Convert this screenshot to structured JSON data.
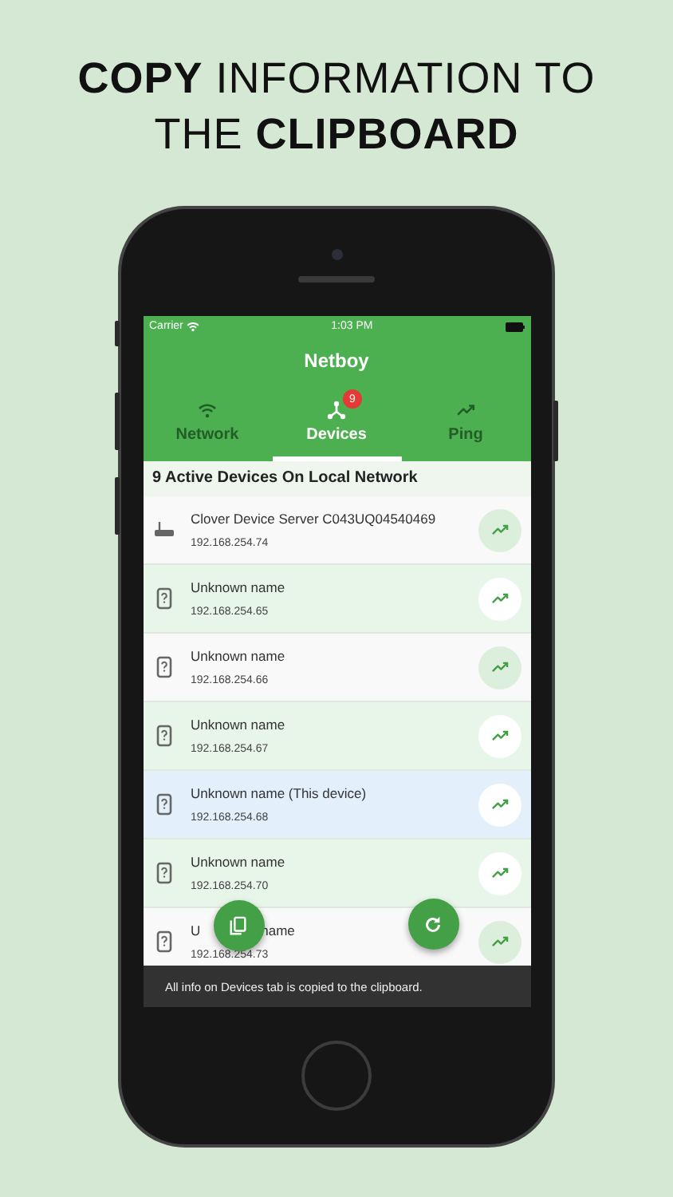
{
  "headline": "**COPY** INFORMATION TO THE **CLIPBOARD**",
  "status_bar": {
    "carrier": "Carrier",
    "time": "1:03 PM"
  },
  "app_bar": {
    "title": "Netboy"
  },
  "tabs": [
    {
      "label": "Network",
      "kind": "wifi",
      "selected": false
    },
    {
      "label": "Devices",
      "kind": "devices",
      "selected": true,
      "badge": "9"
    },
    {
      "label": "Ping",
      "kind": "ping",
      "selected": false
    }
  ],
  "section_title": "9 Active Devices On Local Network",
  "devices": [
    {
      "kind": "router",
      "name": "Clover Device Server C043UQ04540469",
      "ip": "192.168.254.74",
      "current": false
    },
    {
      "kind": "unknown",
      "name": "Unknown name",
      "ip": "192.168.254.65",
      "current": false
    },
    {
      "kind": "unknown",
      "name": "Unknown name",
      "ip": "192.168.254.66",
      "current": false
    },
    {
      "kind": "unknown",
      "name": "Unknown name",
      "ip": "192.168.254.67",
      "current": false
    },
    {
      "kind": "unknown",
      "name": "Unknown name (This device)",
      "ip": "192.168.254.68",
      "current": true
    },
    {
      "kind": "unknown",
      "name": "Unknown name",
      "ip": "192.168.254.70",
      "current": false
    },
    {
      "kind": "unknown",
      "name": "U",
      "name_after_cover": "name",
      "ip": "192.168.254.73",
      "current": false
    }
  ],
  "snackbar": "All info on Devices tab is copied to the clipboard."
}
